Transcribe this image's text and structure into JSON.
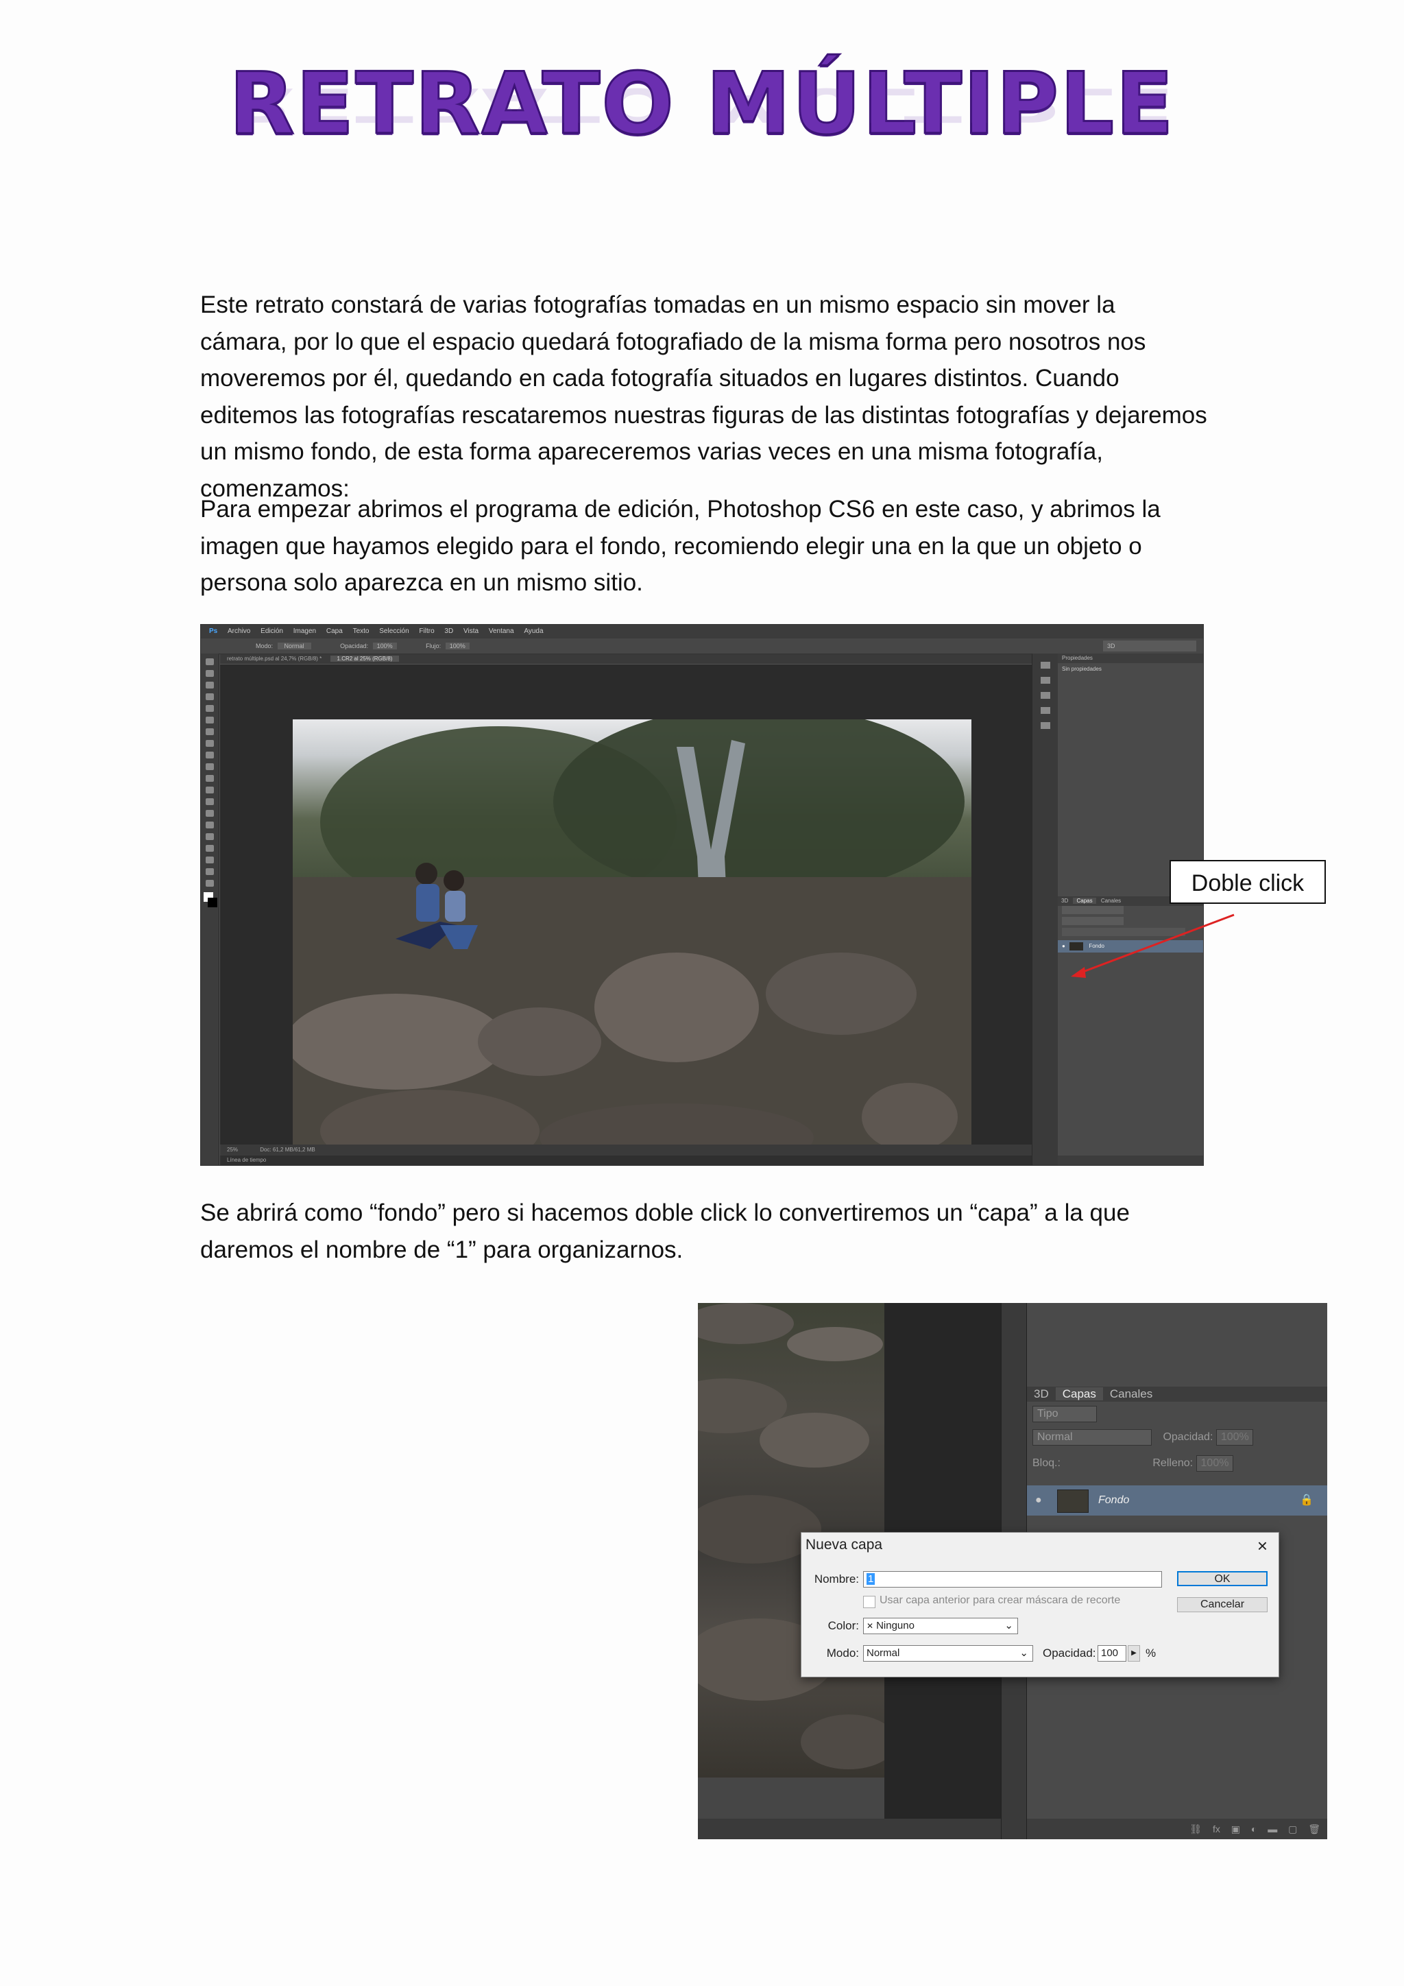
{
  "title": "RETRATO MÚLTIPLE",
  "paragraphs": {
    "p1": "Este retrato constará de varias fotografías tomadas en un mismo espacio sin mover la cámara, por lo que el espacio quedará fotografiado de la misma forma pero nosotros nos moveremos por él, quedando en cada fotografía situados en lugares distintos. Cuando editemos las fotografías rescataremos nuestras figuras de las distintas fotografías y dejaremos un mismo fondo, de esta forma apareceremos varias veces en una misma fotografía, comenzamos:",
    "p2": "Para empezar abrimos el programa de edición, Photoshop CS6 en este caso, y abrimos la imagen que hayamos elegido para el fondo, recomiendo elegir una en la que un objeto o persona solo aparezca en un mismo sitio.",
    "p3": "Se abrirá como “fondo” pero si hacemos doble click lo convertiremos un “capa” a la que daremos el nombre de “1” para organizarnos."
  },
  "screenshot1": {
    "app_logo": "Ps",
    "menu": [
      "Archivo",
      "Edición",
      "Imagen",
      "Capa",
      "Texto",
      "Selección",
      "Filtro",
      "3D",
      "Vista",
      "Ventana",
      "Ayuda"
    ],
    "options": {
      "mode_label": "Modo:",
      "mode_value": "Normal",
      "opacity_label": "Opacidad:",
      "opacity_value": "100%",
      "flow_label": "Flujo:",
      "flow_value": "100%",
      "workspace": "3D"
    },
    "doc_tabs": [
      "retrato múltiple.psd al 24,7% (RGB/8) *",
      "1.CR2 al 25% (RGB/8)"
    ],
    "properties_title": "Propiedades",
    "properties_text": "Sin propiedades",
    "layers_tabs": [
      "3D",
      "Capas",
      "Canales"
    ],
    "layer_name": "Fondo",
    "zoom": "25%",
    "doc_info": "Doc: 61,2 MB/61,2 MB",
    "timeline_label": "Línea de tiempo"
  },
  "callout": "Doble click",
  "screenshot2": {
    "tabs": [
      "3D",
      "Capas",
      "Canales"
    ],
    "filter_label": "Tipo",
    "blend_mode": "Normal",
    "opacity_label": "Opacidad:",
    "opacity_value": "100%",
    "lock_label": "Bloq.:",
    "fill_label": "Relleno:",
    "fill_value": "100%",
    "layer_name": "Fondo",
    "dialog": {
      "title": "Nueva capa",
      "name_label": "Nombre:",
      "name_value": "1",
      "checkbox_label": "Usar capa anterior para crear máscara de recorte",
      "color_label": "Color:",
      "color_value": "Ninguno",
      "mode_label": "Modo:",
      "mode_value": "Normal",
      "opacity_label": "Opacidad:",
      "opacity_value": "100",
      "percent": "%",
      "ok": "OK",
      "cancel": "Cancelar"
    }
  }
}
